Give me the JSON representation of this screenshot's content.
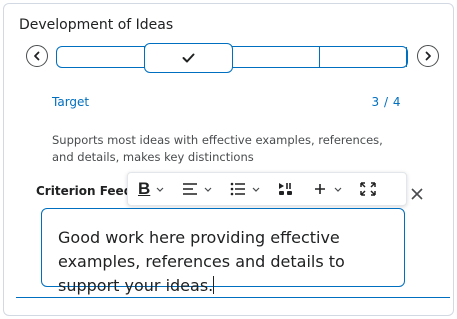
{
  "criterion": {
    "title": "Development of Ideas"
  },
  "level": {
    "name": "Target",
    "score": "3 / 4",
    "selected_index": 1,
    "total_levels": 4,
    "description": "Supports most ideas with effective examples, references, and details, makes key distinctions"
  },
  "feedback": {
    "label": "Criterion Feedback",
    "text": "Good work here providing effective examples, references and details to support your ideas."
  },
  "toolbar": {
    "bold_label": "B",
    "items": [
      "bold",
      "align",
      "list",
      "insert-media",
      "insert",
      "fullscreen"
    ]
  },
  "colors": {
    "accent": "#006fbf",
    "text": "#202122",
    "muted": "#494c4e"
  }
}
